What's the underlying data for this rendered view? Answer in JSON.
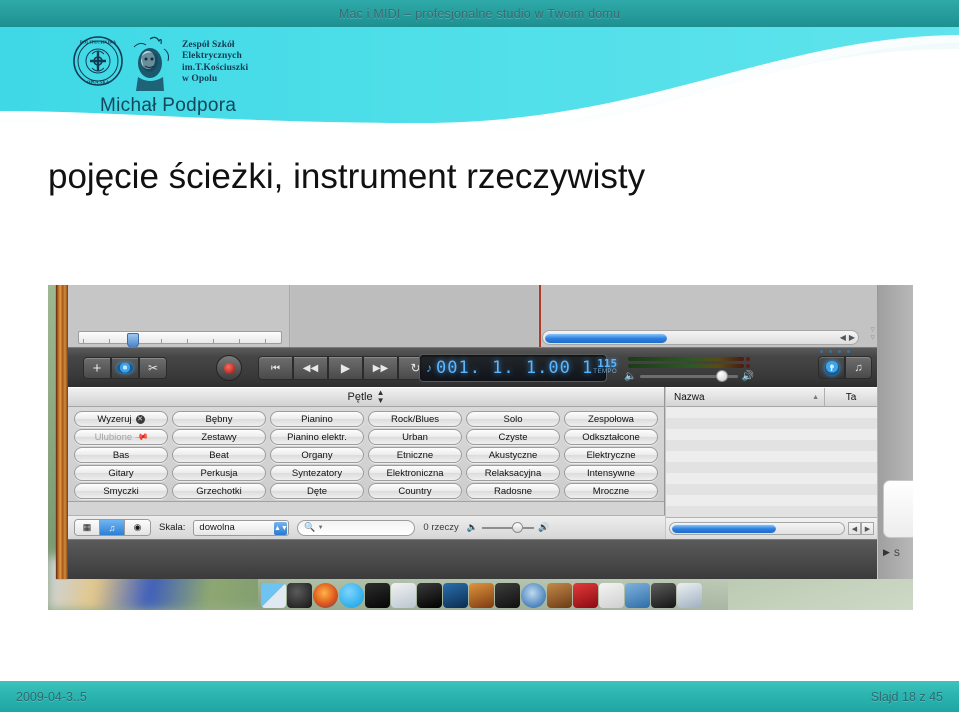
{
  "banner": {
    "title": "Mac i MIDI – profesjonalne studio w Twoim domu"
  },
  "header": {
    "school_lines": "Zespół Szkół\nElektrycznych\nim.T.Kościuszki\nw Opolu",
    "school_line1": "Zespół Szkół",
    "school_line2": "Elektrycznych",
    "school_line3": "im.T.Kościuszki",
    "school_line4": "w Opolu",
    "author": "Michał Podpora",
    "seal_text_top": "POLITECHNIKA",
    "seal_text_bottom": "OPOLSKA"
  },
  "slide": {
    "title": "pojęcie ścieżki, instrument rzeczywisty"
  },
  "garageband": {
    "transport": {
      "add_track_label": "+",
      "lcd_digits": "001. 1. 1.00 1",
      "tempo_value": "115",
      "tempo_label": "TEMPO",
      "note_icon": "♪",
      "info_button_label": "i"
    },
    "loop_browser": {
      "header_title": "Pętle",
      "buttons": [
        [
          "Wyzeruj",
          "Bębny",
          "Pianino",
          "Rock/Blues",
          "Solo",
          "Zespołowa"
        ],
        [
          "Ulubione",
          "Zestawy",
          "Pianino elektr.",
          "Urban",
          "Czyste",
          "Odkształcone"
        ],
        [
          "Bas",
          "Beat",
          "Organy",
          "Etniczne",
          "Akustyczne",
          "Elektryczne"
        ],
        [
          "Gitary",
          "Perkusja",
          "Syntezatory",
          "Elektroniczna",
          "Relaksacyjna",
          "Intensywne"
        ],
        [
          "Smyczki",
          "Grzechotki",
          "Dęte",
          "Country",
          "Radosne",
          "Mroczne"
        ]
      ],
      "footer": {
        "scale_label": "Skala:",
        "scale_value": "dowolna",
        "search_placeholder": "",
        "search_icon": "Q",
        "count_label": "0 rzeczy"
      }
    },
    "results": {
      "col_name": "Nazwa",
      "col_tempo": "Ta"
    },
    "side_panel": {
      "row_label": "S"
    }
  },
  "footer": {
    "date": "2009-04-3..5",
    "slide_counter": "Slajd 18 z 45"
  },
  "colors": {
    "teal": "#2bb5b0",
    "teal_dark": "#1d8f90",
    "cyan": "#4fd8e8",
    "title_text": "#111111",
    "footer_text": "#2f6a70"
  }
}
